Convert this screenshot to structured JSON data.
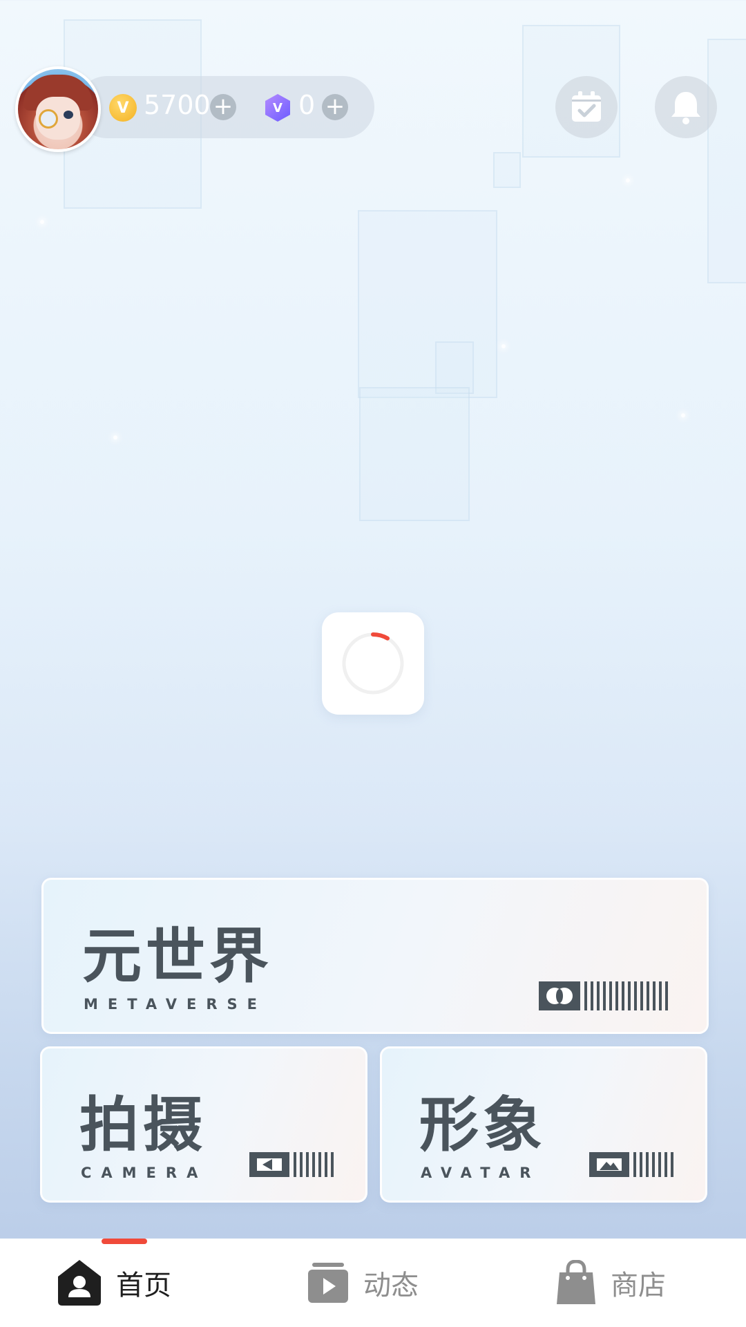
{
  "header": {
    "avatar_icon": "user-avatar",
    "coins": {
      "icon": "gold-coin-icon",
      "symbol": "V",
      "value": "5700"
    },
    "gems": {
      "icon": "purple-gem-icon",
      "symbol": "V",
      "value": "0"
    },
    "plus_symbol": "+",
    "checkin_icon": "calendar-check-icon",
    "notification_icon": "bell-icon"
  },
  "loader": {
    "icon": "loading-spinner-icon",
    "accent": "#f04a3a"
  },
  "cards": {
    "metaverse": {
      "title": "元世界",
      "subtitle": "METAVERSE"
    },
    "camera": {
      "title": "拍摄",
      "subtitle": "CAMERA"
    },
    "avatar": {
      "title": "形象",
      "subtitle": "AVATAR"
    }
  },
  "tabs": [
    {
      "label": "首页",
      "icon": "home-user-icon",
      "active": true
    },
    {
      "label": "动态",
      "icon": "video-feed-icon",
      "active": false
    },
    {
      "label": "商店",
      "icon": "shopping-bag-icon",
      "active": false
    }
  ],
  "colors": {
    "accent": "#f04a3a",
    "text_dark": "#4a545c",
    "tab_inactive": "#8e8e8e"
  }
}
